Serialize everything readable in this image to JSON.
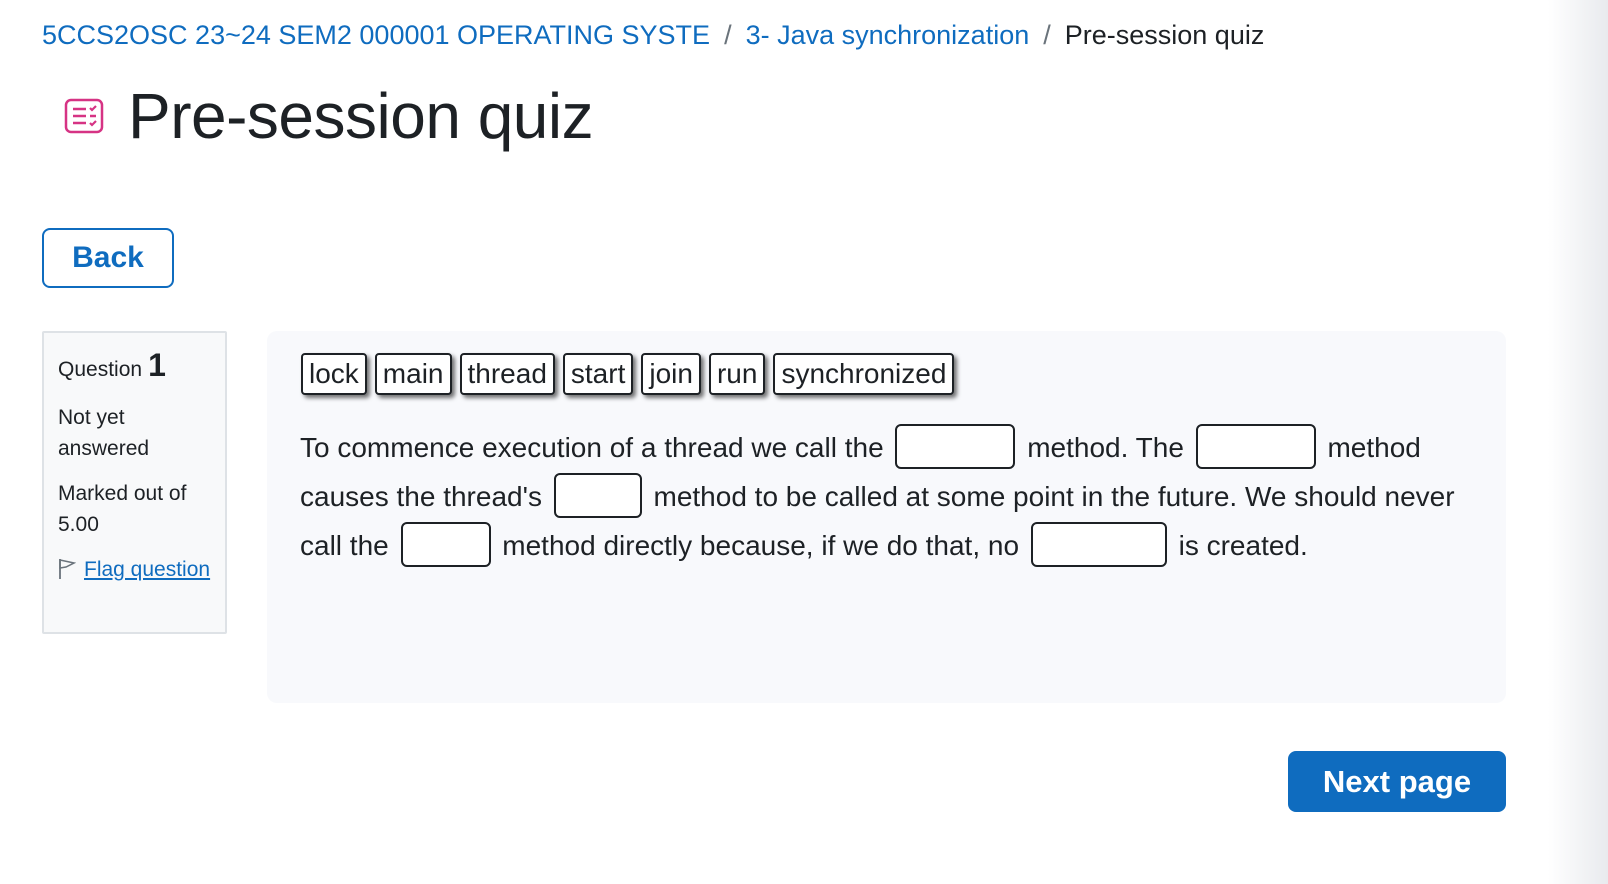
{
  "breadcrumb": {
    "items": [
      "5CCS2OSC 23~24 SEM2 000001 OPERATING SYSTE",
      "3- Java synchronization"
    ],
    "separator": "/",
    "current": "Pre-session quiz"
  },
  "page": {
    "title": "Pre-session quiz",
    "icon": "quiz-icon"
  },
  "buttons": {
    "back": "Back",
    "next": "Next page"
  },
  "question_info": {
    "label": "Question",
    "number": "1",
    "state": "Not yet answered",
    "grade": "Marked out of 5.00",
    "flag_label": "Flag question",
    "flag_icon": "flag-icon"
  },
  "question": {
    "drag_items": [
      "lock",
      "main",
      "thread",
      "start",
      "join",
      "run",
      "synchronized"
    ],
    "text": {
      "p1": "To commence execution of a thread we call the",
      "p2": "method. The",
      "p3": "method causes the thread's",
      "p4": "method to be called at some point in the future. We should never call the",
      "p5": "method directly because, if we do that, no",
      "p6": "is created."
    }
  },
  "colors": {
    "link": "#0f6cbf",
    "primary": "#0f6cbf",
    "icon": "#d63384",
    "text": "#1d2125"
  }
}
